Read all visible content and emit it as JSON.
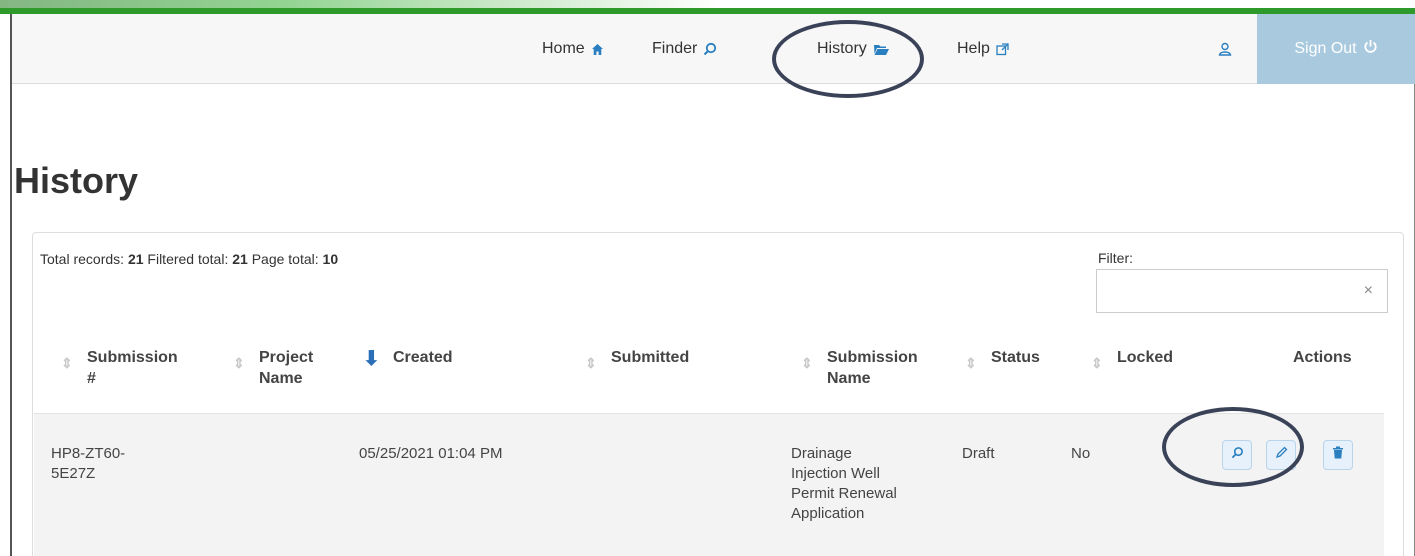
{
  "nav": {
    "home": "Home",
    "finder": "Finder",
    "history": "History",
    "help": "Help",
    "sign_out": "Sign Out"
  },
  "page": {
    "title": "History"
  },
  "summary": {
    "total_label": "Total records:",
    "total_value": "21",
    "filtered_label": "Filtered total:",
    "filtered_value": "21",
    "page_label": "Page total:",
    "page_value": "10"
  },
  "filter": {
    "label": "Filter:",
    "value": "",
    "clear": "×"
  },
  "table": {
    "headers": {
      "submission_no": [
        "Submission",
        "#"
      ],
      "project_name": [
        "Project",
        "Name"
      ],
      "created": "Created",
      "submitted": "Submitted",
      "submission_name": [
        "Submission",
        "Name"
      ],
      "status": "Status",
      "locked": "Locked",
      "actions": "Actions"
    },
    "rows": [
      {
        "submission_no": [
          "HP8-ZT60-",
          "5E27Z"
        ],
        "project_name": "",
        "created": "05/25/2021 01:04 PM",
        "submitted": "",
        "submission_name": [
          "Drainage",
          "Injection Well",
          "Permit Renewal",
          "Application"
        ],
        "status": "Draft",
        "locked": "No"
      }
    ]
  },
  "colors": {
    "accent_green": "#2e9a2c",
    "icon_blue": "#2a7fc1",
    "signout_bg": "#a9c9df",
    "highlight_oval": "#3a4258"
  }
}
